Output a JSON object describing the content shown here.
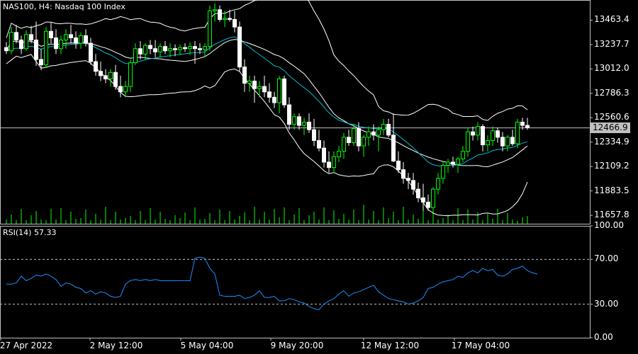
{
  "window": {
    "symbol": "NAS100",
    "timeframe": "H4",
    "description": "Nasdaq 100 Index",
    "title": "NAS100, H4:  Nasdaq 100 Index"
  },
  "colors": {
    "background": "#000000",
    "bull_candle": "#00ff00",
    "bear_candle": "#ffffff",
    "volume": "#00ff00",
    "bollinger": "#ffffff",
    "moving_average": "#00bcd4",
    "rsi_line": "#1e90ff",
    "grid_levels": "#c0c0c0",
    "frame": "#c0c0c0"
  },
  "price_panel": {
    "current_price": "12466.9",
    "y_labels": [
      "13463.4",
      "13237.7",
      "13012.0",
      "12786.3",
      "12560.6",
      "12334.9",
      "12109.2",
      "11883.5",
      "11657.8"
    ]
  },
  "rsi_panel": {
    "title": "RSI(14) 57.33",
    "y_labels": [
      "100.00",
      "70.00",
      "30.00",
      "0.00"
    ],
    "levels": [
      70,
      30
    ]
  },
  "time_axis": {
    "labels": [
      "27 Apr 2022",
      "2 May 12:00",
      "5 May 04:00",
      "9 May 20:00",
      "12 May 12:00",
      "17 May 04:00"
    ]
  },
  "chart_data": {
    "type": "candlestick",
    "title": "NAS100, H4:  Nasdaq 100 Index",
    "ylim": [
      11580,
      13650
    ],
    "candles": [
      [
        13210,
        13260,
        13150,
        13180
      ],
      [
        13180,
        13400,
        13150,
        13350
      ],
      [
        13350,
        13420,
        13250,
        13280
      ],
      [
        13280,
        13320,
        13150,
        13200
      ],
      [
        13200,
        13370,
        13180,
        13330
      ],
      [
        13330,
        13410,
        13250,
        13280
      ],
      [
        13280,
        13450,
        13040,
        13100
      ],
      [
        13100,
        13200,
        13000,
        13050
      ],
      [
        13050,
        13400,
        13020,
        13360
      ],
      [
        13360,
        13440,
        13250,
        13300
      ],
      [
        13300,
        13380,
        13150,
        13200
      ],
      [
        13200,
        13320,
        13150,
        13280
      ],
      [
        13280,
        13380,
        13200,
        13330
      ],
      [
        13330,
        13420,
        13250,
        13300
      ],
      [
        13300,
        13360,
        13200,
        13250
      ],
      [
        13250,
        13350,
        13200,
        13320
      ],
      [
        13320,
        13380,
        13220,
        13250
      ],
      [
        13250,
        13300,
        13050,
        13080
      ],
      [
        13080,
        13150,
        12950,
        12990
      ],
      [
        12990,
        13080,
        12900,
        12950
      ],
      [
        12950,
        13010,
        12880,
        12920
      ],
      [
        12920,
        13010,
        12850,
        12980
      ],
      [
        12980,
        13050,
        12820,
        12850
      ],
      [
        12850,
        12950,
        12750,
        12800
      ],
      [
        12800,
        12900,
        12750,
        12850
      ],
      [
        12850,
        13100,
        12800,
        13070
      ],
      [
        13070,
        13250,
        13050,
        13200
      ],
      [
        13200,
        13270,
        13100,
        13150
      ],
      [
        13150,
        13250,
        13100,
        13230
      ],
      [
        13230,
        13280,
        13150,
        13200
      ],
      [
        13200,
        13280,
        13120,
        13170
      ],
      [
        13170,
        13250,
        13120,
        13220
      ],
      [
        13220,
        13270,
        13150,
        13180
      ],
      [
        13180,
        13250,
        13120,
        13200
      ],
      [
        13200,
        13240,
        13130,
        13190
      ],
      [
        13190,
        13240,
        13140,
        13210
      ],
      [
        13210,
        13250,
        13170,
        13200
      ],
      [
        13200,
        13260,
        13140,
        13220
      ],
      [
        13220,
        13270,
        13060,
        13200
      ],
      [
        13200,
        13250,
        13150,
        13190
      ],
      [
        13190,
        13250,
        13120,
        13220
      ],
      [
        13220,
        13600,
        13180,
        13550
      ],
      [
        13550,
        13620,
        13450,
        13560
      ],
      [
        13560,
        13600,
        13450,
        13470
      ],
      [
        13470,
        13550,
        13400,
        13480
      ],
      [
        13480,
        13560,
        13450,
        13470
      ],
      [
        13470,
        13550,
        13350,
        13400
      ],
      [
        13400,
        13450,
        12990,
        13030
      ],
      [
        13030,
        13100,
        12800,
        12880
      ],
      [
        12880,
        12950,
        12800,
        12900
      ],
      [
        12900,
        12950,
        12700,
        12830
      ],
      [
        12830,
        12900,
        12750,
        12850
      ],
      [
        12850,
        12950,
        12750,
        12800
      ],
      [
        12800,
        12880,
        12700,
        12750
      ],
      [
        12750,
        12800,
        12650,
        12700
      ],
      [
        12700,
        12950,
        12600,
        12920
      ],
      [
        12920,
        12950,
        12650,
        12680
      ],
      [
        12680,
        12750,
        12450,
        12500
      ],
      [
        12500,
        12600,
        12450,
        12570
      ],
      [
        12570,
        12600,
        12450,
        12490
      ],
      [
        12490,
        12560,
        12400,
        12520
      ],
      [
        12520,
        12600,
        12420,
        12450
      ],
      [
        12450,
        12550,
        12300,
        12350
      ],
      [
        12350,
        12450,
        12250,
        12280
      ],
      [
        12280,
        12350,
        12100,
        12150
      ],
      [
        12150,
        12250,
        12050,
        12100
      ],
      [
        12100,
        12250,
        12050,
        12200
      ],
      [
        12200,
        12300,
        12150,
        12250
      ],
      [
        12250,
        12420,
        12180,
        12380
      ],
      [
        12380,
        12450,
        12300,
        12330
      ],
      [
        12330,
        12500,
        12300,
        12460
      ],
      [
        12460,
        12520,
        12250,
        12300
      ],
      [
        12300,
        12400,
        12200,
        12380
      ],
      [
        12380,
        12480,
        12300,
        12430
      ],
      [
        12430,
        12500,
        12350,
        12400
      ],
      [
        12400,
        12480,
        12250,
        12450
      ],
      [
        12450,
        12550,
        12400,
        12500
      ],
      [
        12500,
        12550,
        12380,
        12400
      ],
      [
        12400,
        12600,
        12150,
        12160
      ],
      [
        12160,
        12250,
        12050,
        12080
      ],
      [
        12080,
        12150,
        11950,
        12000
      ],
      [
        12000,
        12050,
        11900,
        11980
      ],
      [
        11980,
        12050,
        11850,
        11900
      ],
      [
        11900,
        11960,
        11780,
        11820
      ],
      [
        11820,
        11950,
        11700,
        11780
      ],
      [
        11780,
        11850,
        11700,
        11730
      ],
      [
        11730,
        11920,
        11700,
        11900
      ],
      [
        11900,
        12050,
        11850,
        12000
      ],
      [
        12000,
        12150,
        11950,
        12120
      ],
      [
        12120,
        12180,
        12050,
        12150
      ],
      [
        12150,
        12200,
        12100,
        12130
      ],
      [
        12130,
        12200,
        12050,
        12180
      ],
      [
        12180,
        12300,
        12150,
        12250
      ],
      [
        12250,
        12470,
        12200,
        12430
      ],
      [
        12430,
        12480,
        12350,
        12400
      ],
      [
        12400,
        12520,
        12350,
        12480
      ],
      [
        12480,
        12500,
        12250,
        12310
      ],
      [
        12310,
        12400,
        12250,
        12350
      ],
      [
        12350,
        12480,
        12300,
        12440
      ],
      [
        12440,
        12470,
        12330,
        12380
      ],
      [
        12380,
        12430,
        12250,
        12300
      ],
      [
        12300,
        12400,
        12250,
        12380
      ],
      [
        12380,
        12450,
        12300,
        12320
      ],
      [
        12320,
        12550,
        12280,
        12520
      ],
      [
        12520,
        12560,
        12450,
        12490
      ],
      [
        12490,
        12560,
        12450,
        12470
      ]
    ],
    "volume": [
      6,
      13,
      5,
      21,
      5,
      12,
      18,
      6,
      5,
      21,
      6,
      22,
      5,
      17,
      7,
      8,
      20,
      5,
      14,
      6,
      24,
      5,
      17,
      6,
      8,
      11,
      5,
      18,
      5,
      22,
      6,
      17,
      7,
      5,
      12,
      8,
      16,
      5,
      23,
      6,
      7,
      15,
      5,
      20,
      5,
      18,
      6,
      11,
      16,
      5,
      24,
      6,
      17,
      6,
      21,
      9,
      23,
      5,
      13,
      22,
      5,
      12,
      17,
      6,
      23,
      5,
      19,
      7,
      14,
      6,
      20,
      5,
      27,
      6,
      18,
      5,
      23,
      8,
      17,
      5,
      24,
      6,
      13,
      7,
      19,
      5,
      21,
      6,
      8,
      13,
      5,
      22,
      5,
      20,
      6,
      16,
      5,
      14,
      7,
      21,
      5,
      15,
      6,
      4,
      9,
      11,
      5,
      10
    ],
    "rsi": [
      48,
      48,
      49,
      55,
      51,
      53,
      56,
      55,
      57,
      55,
      52,
      46,
      49,
      48,
      45,
      44,
      40,
      42,
      39,
      41,
      40,
      37,
      36,
      37,
      48,
      51,
      52,
      51,
      52,
      51,
      52,
      51,
      51,
      51,
      51,
      51,
      51,
      51,
      71,
      72,
      71,
      62,
      57,
      38,
      37,
      37,
      37,
      38,
      35,
      36,
      38,
      42,
      36,
      36,
      37,
      33,
      33,
      35,
      34,
      32,
      31,
      28,
      26,
      25,
      30,
      33,
      35,
      39,
      42,
      37,
      40,
      41,
      43,
      45,
      47,
      41,
      38,
      35,
      34,
      33,
      32,
      30,
      31,
      33,
      36,
      44,
      45,
      48,
      50,
      51,
      52,
      55,
      54,
      58,
      60,
      58,
      62,
      60,
      61,
      56,
      55,
      57,
      61,
      62,
      64,
      60,
      58,
      57
    ]
  }
}
